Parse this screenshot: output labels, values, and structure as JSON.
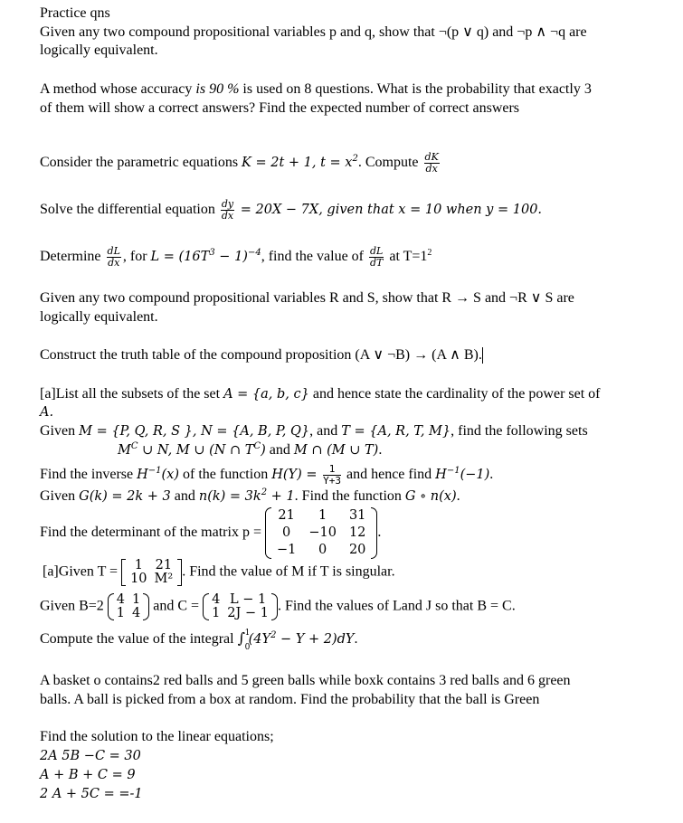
{
  "document": {
    "heading": "Practice qns",
    "q1": {
      "l1a": "Given any two compound propositional variables p and q, show that ¬(p ∨ q) and ¬p ∧ ¬q are",
      "l1b": "logically equivalent."
    },
    "q2": {
      "l1a": "A method whose accuracy ",
      "l1b": "is 90 %",
      "l1c": " is used on 8 questions. What is the probability that exactly 3",
      "l2": "of them will show a correct answers? Find the expected number of correct answers"
    },
    "q3": {
      "text": "Consider the parametric equations ",
      "eq": "K = 2t + 1, t = x",
      "exp": "2",
      "after": ". Compute ",
      "frac_num": "dK",
      "frac_den": "dx"
    },
    "q4": {
      "text": "Solve the differential equation ",
      "frac_num": "dy",
      "frac_den": "dx",
      "eq": " = 20X − 7X, given that x = 10 when y = 100."
    },
    "q5": {
      "text": "Determine ",
      "frac1_num": "dL",
      "frac1_den": "dx",
      "mid": ", for ",
      "eq": "L = (16T",
      "exp1": "3",
      "eq2": " − 1)",
      "exp2": "−4",
      "mid2": ", find the value of ",
      "frac2_num": "dL",
      "frac2_den": "dT",
      "end": " at T=1",
      "exp3": "2"
    },
    "q6": {
      "l1": "Given any two compound propositional variables R and  S, show that R → S and ¬R ∨ S are",
      "l2": "logically equivalent."
    },
    "q7": {
      "text": "Construct the truth table of the compound proposition (A ∨ ¬B) → (A ∧ B)."
    },
    "q8": {
      "l1a": " [a]List all the subsets of the set ",
      "l1b": "A = {a, b, c}",
      "l1c": " and hence state the cardinality of the power set of",
      "l2": "A."
    },
    "q9": {
      "l1a": "Given ",
      "l1b": "M = {P, Q, R, S }, N = {A, B, P, Q}",
      "l1c": ", and ",
      "l1d": "T = {A, R, T, M}",
      "l1e": ", find the following sets",
      "l2a": "M",
      "l2a_sup": "C",
      "l2b": " ∪ N, M ∪ (N ∩ T",
      "l2b_sup": "C",
      "l2c": ")",
      "l2d": " and ",
      "l2e": "M ∩ (M ∪ T)",
      "l2f": "."
    },
    "q10": {
      "a": "Find the inverse  ",
      "b": "H",
      "b_sup": "−1",
      "c": "(x)",
      "d": "  of the function ",
      "e": "H(Y) = ",
      "frac_num": "1",
      "frac_den": "Y+3",
      "f": " and hence find  ",
      "g": "H",
      "g_sup": "−1",
      "h": "(−1)",
      "i": "."
    },
    "q11": {
      "a": "Given ",
      "b": "G(k) =  2k + 3",
      "c": " and ",
      "d": "n(k) = 3k",
      "d_sup": "2",
      "e": " + 1",
      "f": ". Find the function ",
      "g": "G ∘ n(x)",
      "h": "."
    },
    "q12": {
      "text": "Find the determinant of the matrix p = ",
      "matrix": [
        [
          "21",
          "1",
          "31"
        ],
        [
          "0",
          "−10",
          "12"
        ],
        [
          "−1",
          "0",
          "20"
        ]
      ],
      "end": "."
    },
    "q13": {
      "text": " [a]Given T = ",
      "matrix": [
        [
          "1",
          "21"
        ],
        [
          "10",
          "M²"
        ]
      ],
      "end": ". Find the value of M if T is singular."
    },
    "q14": {
      "a": "Given B=2 ",
      "matrixB": [
        [
          "4",
          "1"
        ],
        [
          "1",
          "4"
        ]
      ],
      "b": " and C = ",
      "matrixC": [
        [
          "4",
          "L − 1"
        ],
        [
          "1",
          "2J − 1"
        ]
      ],
      "c": ". Find the values of Land J so that B = C."
    },
    "q15": {
      "a": "Compute the value of the integral ",
      "int_upper": "1",
      "int_lower": "0",
      "b": "(4Y",
      "b_sup": "2",
      "c": " − Y + 2)dY",
      "d": "."
    },
    "q16": {
      "l1": "A basket o contains2 red balls and 5 green balls while boxk  contains 3 red balls and 6 green",
      "l2": "balls. A ball is picked from a box at random. Find the probability that the ball is Green"
    },
    "q17": {
      "intro": "Find the solution to the linear equations;",
      "eqs": [
        "2A 5B −C = 30",
        "A + B + C = 9",
        "2 A + 5C = =-1"
      ]
    }
  }
}
